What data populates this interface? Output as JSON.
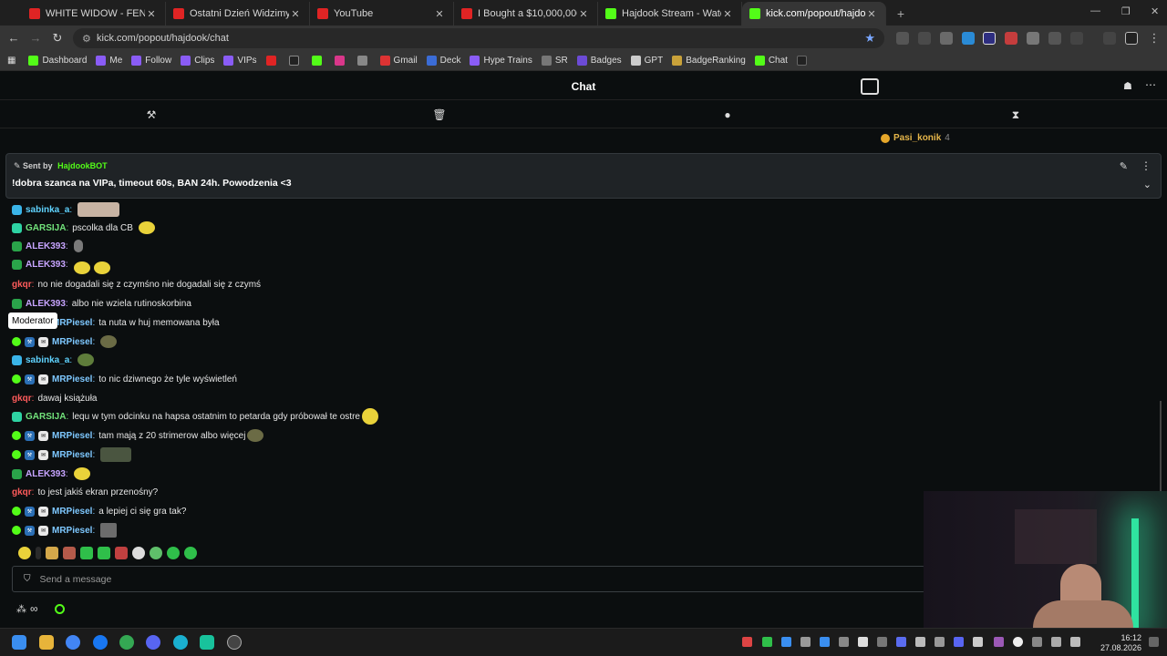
{
  "browser": {
    "tabs": [
      {
        "title": "WHITE WIDOW - FENOMENALNY",
        "favicon": "youtube",
        "active": false
      },
      {
        "title": "Ostatni Dzień Widzimy to Zbroję",
        "favicon": "youtube",
        "active": false
      },
      {
        "title": "YouTube",
        "favicon": "youtube",
        "active": false
      },
      {
        "title": "I Bought a $10,000,000 House!",
        "favicon": "youtube",
        "active": false
      },
      {
        "title": "Hajdook Stream - Watch Live on",
        "favicon": "kick",
        "active": false
      },
      {
        "title": "kick.com/popout/hajdook/chat",
        "favicon": "kick",
        "active": true
      }
    ],
    "url": "kick.com/popout/hajdook/chat",
    "bookmarks": [
      "Dashboard",
      "Me",
      "Follow",
      "Clips",
      "VIPs",
      "",
      "",
      "",
      "",
      "",
      "Gmail",
      "Deck",
      "Hype Trains",
      "SR",
      "Badges",
      "GPT",
      "BadgeRanking",
      "Chat",
      ""
    ]
  },
  "chat": {
    "header_title": "Chat",
    "top_user": {
      "name": "Pasi_konik",
      "count": "4"
    },
    "pinned": {
      "sent_by_label": "Sent by",
      "sender": "HajdookBOT",
      "message": "!dobra szanca na VIPa, timeout 60s, BAN 24h. Powodzenia <3"
    },
    "tooltip": "Moderator",
    "messages": [
      {
        "user": "sabinka_a",
        "badge": "38",
        "text": "",
        "emotes": [
          "pic"
        ]
      },
      {
        "user": "GARSIJA",
        "badge": "32",
        "text": "pscolka dla CB",
        "emotes": [
          "yellow"
        ]
      },
      {
        "user": "ALEK393",
        "badge": "45",
        "text": "",
        "emotes": [
          "blob"
        ]
      },
      {
        "user": "ALEK393",
        "badge": "45",
        "text": "",
        "emotes": [
          "yellow",
          "yellow"
        ]
      },
      {
        "user": "gkqr",
        "badge": "",
        "text": "no nie dogadali się z czymśno nie dogadali się z czymś",
        "emotes": []
      },
      {
        "user": "ALEK393",
        "badge": "45",
        "text": "albo nie wziela rutinoskorbina",
        "emotes": []
      },
      {
        "user": "MRPiesel",
        "badge": "mod",
        "text": "ta nuta w huj memowana była",
        "emotes": []
      },
      {
        "user": "MRPiesel",
        "badge": "mod",
        "text": "",
        "emotes": [
          "soldier"
        ]
      },
      {
        "user": "sabinka_a",
        "badge": "38",
        "text": "",
        "emotes": [
          "frog"
        ]
      },
      {
        "user": "MRPiesel",
        "badge": "mod",
        "text": "to nic dziwnego że tyle wyświetleń",
        "emotes": []
      },
      {
        "user": "gkqr",
        "badge": "",
        "text": "dawaj książuła",
        "emotes": []
      },
      {
        "user": "GARSIJA",
        "badge": "32",
        "text": "lequ w tym odcinku na hapsa ostatnim to petarda gdy próbował te ostre",
        "emotes": [
          "yellow"
        ]
      },
      {
        "user": "MRPiesel",
        "badge": "mod",
        "text": "tam mają z 20 strimerow albo więcej",
        "emotes": [
          "soldier"
        ]
      },
      {
        "user": "MRPiesel",
        "badge": "mod",
        "text": "",
        "emotes": [
          "tank"
        ]
      },
      {
        "user": "ALEK393",
        "badge": "45",
        "text": "",
        "emotes": [
          "yellow"
        ]
      },
      {
        "user": "gkqr",
        "badge": "",
        "text": "to jest jakiś ekran przenośny?",
        "emotes": []
      },
      {
        "user": "MRPiesel",
        "badge": "mod",
        "text": "a lepiej ci się gra tak?",
        "emotes": []
      },
      {
        "user": "MRPiesel",
        "badge": "mod",
        "text": "",
        "emotes": [
          "photo"
        ]
      }
    ],
    "input_placeholder": "Send a message",
    "footer_symbol": "∞"
  },
  "taskbar": {
    "time": "16:12",
    "date": "27.08.2026"
  },
  "colors": {
    "kick_green": "#53fc18",
    "background": "#0b0e0f"
  }
}
